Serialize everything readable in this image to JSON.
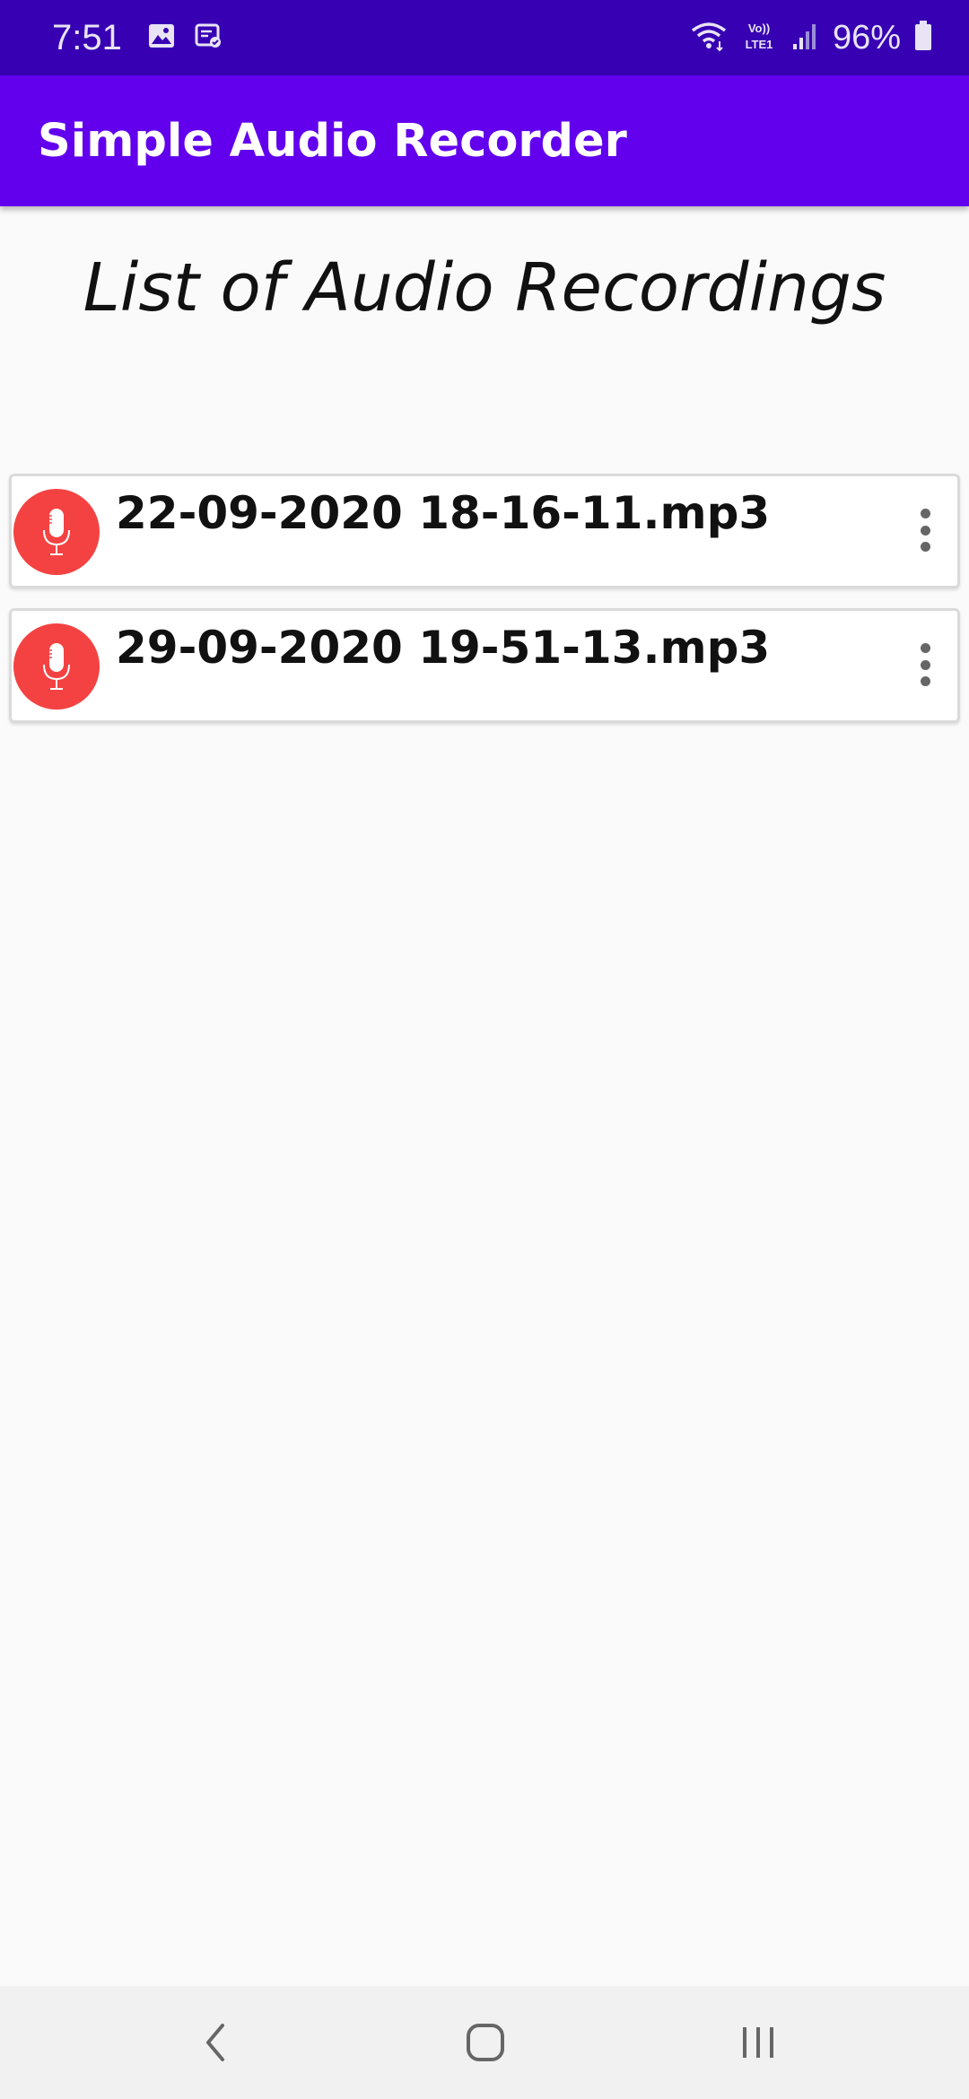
{
  "status_bar": {
    "time": "7:51",
    "battery": "96%",
    "network_label": "Vo) LTE1",
    "icons": [
      "image-icon",
      "message-icon",
      "wifi-icon",
      "volte-icon",
      "signal-icon",
      "battery-icon"
    ]
  },
  "app_bar": {
    "title": "Simple Audio Recorder"
  },
  "main": {
    "heading": "List of Audio Recordings",
    "recordings": [
      {
        "name": "22-09-2020 18-16-11.mp3",
        "icon": "microphone-icon"
      },
      {
        "name": "29-09-2020 19-51-13.mp3",
        "icon": "microphone-icon"
      }
    ]
  },
  "nav_bar": {
    "buttons": [
      "back-icon",
      "home-icon",
      "recents-icon"
    ]
  },
  "colors": {
    "status_bar": "#3700b3",
    "app_bar": "#6200ee",
    "mic_avatar": "#f44242",
    "background": "#fafafa"
  }
}
